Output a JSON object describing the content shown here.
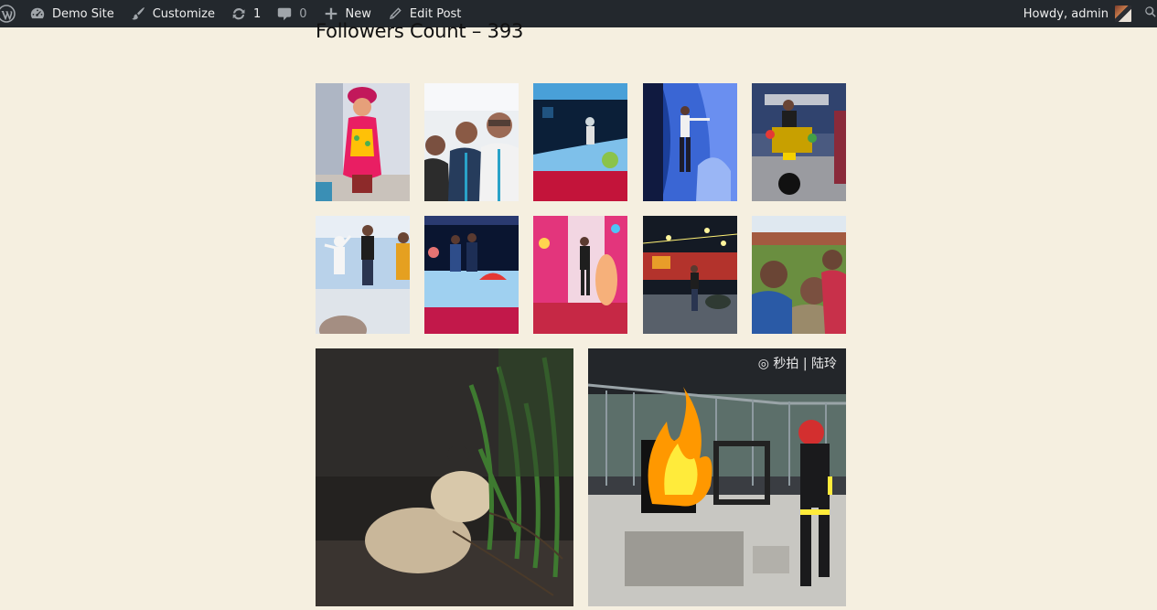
{
  "admin_bar": {
    "site_name": "Demo Site",
    "customize": "Customize",
    "updates_count": "1",
    "comments_count": "0",
    "new_label": "New",
    "edit_post": "Edit Post",
    "howdy": "Howdy, admin",
    "icons": [
      "wordpress-logo-icon",
      "dashboard-icon",
      "brush-icon",
      "updates-icon",
      "comment-icon",
      "plus-icon",
      "pencil-icon",
      "search-icon"
    ]
  },
  "content": {
    "followers_heading": "Followers Count – 393",
    "gallery_row1": [
      "Idol decorated in pink and gold",
      "Three friends selfie",
      "Person posing at fruit-themed stage",
      "Person posing in blue tunnel",
      "Person on decorated motorbike"
    ],
    "gallery_row2": [
      "Person posing with cutout",
      "Two people at fruit-themed booth",
      "Person posing in pink booth",
      "Night fair with lights",
      "Selfie with temple behind"
    ],
    "large_posts": [
      "Lion cub among grass",
      "Firefighter near burning object"
    ],
    "video_watermark": "◎ 秒拍 | 陆玲"
  },
  "colors": {
    "admin_bar_bg": "#23282d",
    "page_bg": "#f5efe0"
  }
}
